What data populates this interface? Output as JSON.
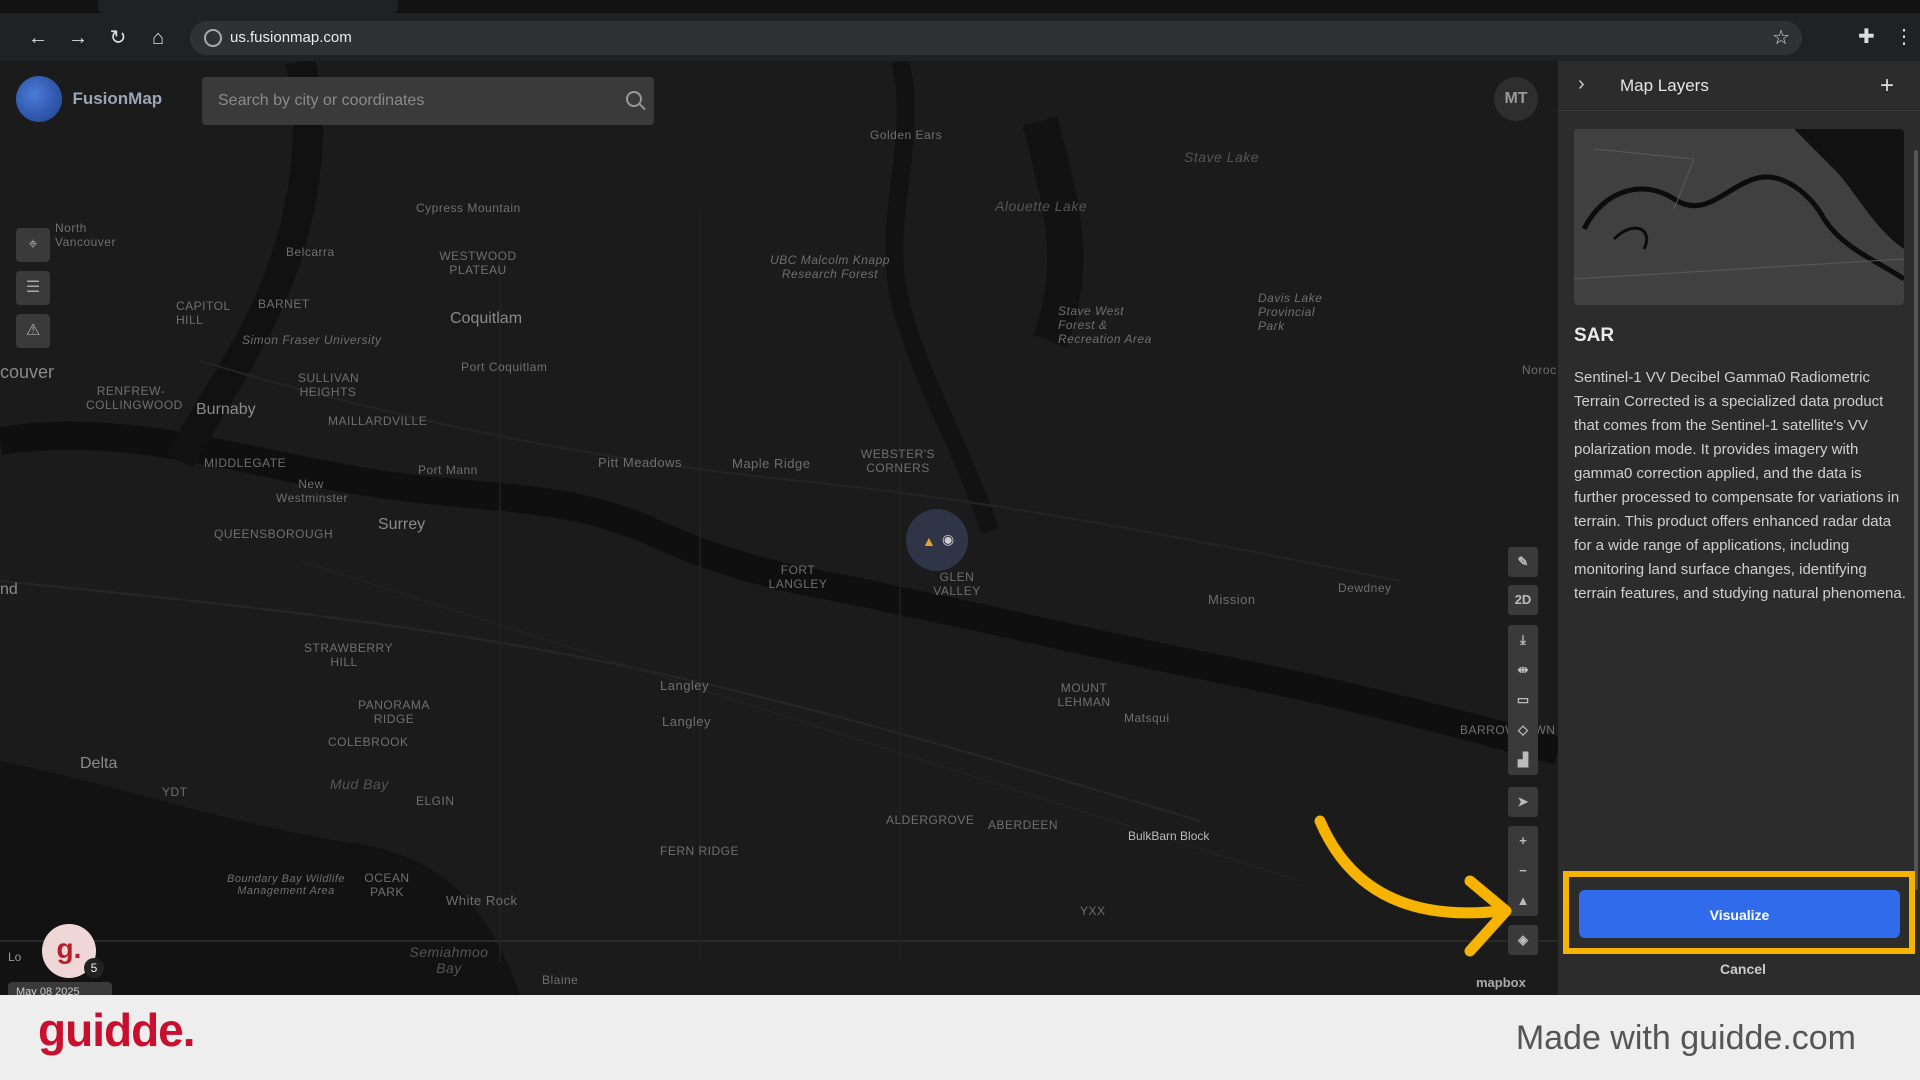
{
  "browser": {
    "url": "us.fusionmap.com"
  },
  "app": {
    "logo_text": "FusionMap",
    "search_placeholder": "Search by city or coordinates",
    "avatar_initials": "MT"
  },
  "map": {
    "places": [
      "Golden Ears",
      "Stave Lake",
      "Alouette Lake",
      "Cypress Mountain",
      "North Vancouver",
      "Belcarra",
      "WESTWOOD PLATEAU",
      "UBC Malcolm Knapp Research Forest",
      "Stave West Forest & Recreation Area",
      "Davis Lake Provincial Park",
      "CAPITOL HILL",
      "BARNET",
      "Coquitlam",
      "Simon Fraser University",
      "couver",
      "SULLIVAN HEIGHTS",
      "Port Coquitlam",
      "RENFREW-COLLINGWOOD",
      "Burnaby",
      "MAILLARDVILLE",
      "MIDDLEGATE",
      "Port Mann",
      "Pitt Meadows",
      "Maple Ridge",
      "WEBSTER'S CORNERS",
      "New Westminster",
      "QUEENSBOROUGH",
      "Surrey",
      "FORT LANGLEY",
      "GLEN VALLEY",
      "Mission",
      "Dewdney",
      "nd",
      "STRAWBERRY HILL",
      "Langley",
      "Langley",
      "MOUNT LEHMAN",
      "Matsqui",
      "PANORAMA RIDGE",
      "COLEBROOK",
      "BARROWTOWN",
      "Delta",
      "Mud Bay",
      "YDT",
      "ELGIN",
      "ALDERGROVE",
      "ABERDEEN",
      "FERN RIDGE",
      "Boundary Bay Wildlife Management Area",
      "OCEAN PARK",
      "White Rock",
      "YXX",
      "Semiahmoo Bay",
      "Blaine",
      "Noroc"
    ],
    "business_label": "BulkBarn Block",
    "attribution": "mapbox",
    "broken_logo_alt": "Lo",
    "date_chip": "May 08 2025",
    "guidde_badge": "g.",
    "badge_count": "5",
    "right_tools": {
      "mode_2d": "2D"
    }
  },
  "panel": {
    "title": "Map Layers",
    "add_icon": "+",
    "layer_name": "SAR",
    "layer_description": "Sentinel-1 VV Decibel Gamma0 Radiometric Terrain Corrected is a specialized data product that comes from the Sentinel-1 satellite's VV polarization mode. It provides imagery with gamma0 correction applied, and the data is further processed to compensate for variations in terrain. This product offers enhanced radar data for a wide range of applications, including monitoring land surface changes, identifying terrain features, and studying natural phenomena.",
    "visualize_label": "Visualize",
    "cancel_label": "Cancel"
  },
  "footer": {
    "brand": "guidde.",
    "made_with": "Made with guidde.com"
  },
  "colors": {
    "accent_blue": "#2f6bea",
    "highlight_yellow": "#f6b400",
    "brand_red": "#c8102e"
  }
}
